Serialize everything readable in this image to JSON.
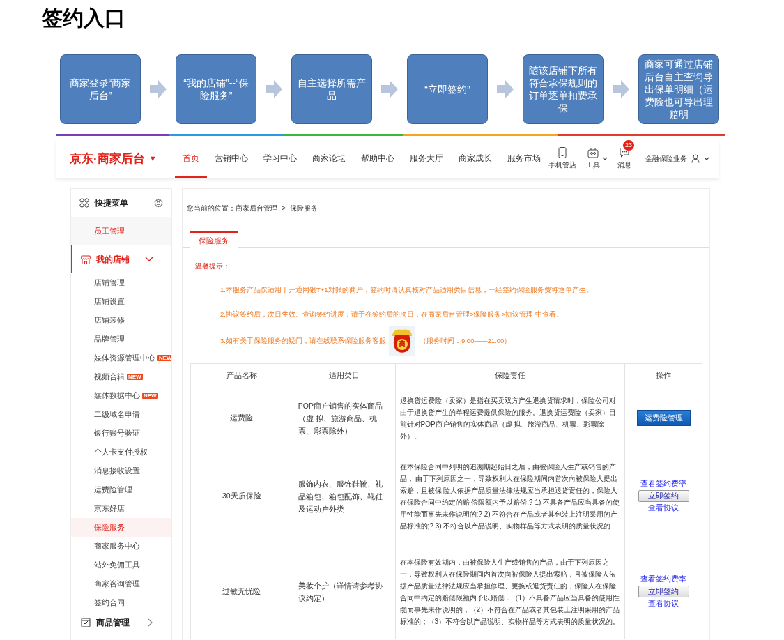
{
  "page_title": "签约入口",
  "flow": [
    {
      "text": "商家登录“商家后台”"
    },
    {
      "text": "“我的店铺”--“保险服务”"
    },
    {
      "text": "自主选择所需产品"
    },
    {
      "text": "“立即签约”"
    },
    {
      "text": "随该店铺下所有符合承保规则的订单逐单扣费承保"
    },
    {
      "text": "商家可通过店铺后台自主查询导出保单明细（运费险也可导出理赔明"
    }
  ],
  "header": {
    "logo": "京东·商家后台",
    "logo_caret": "▼",
    "nav": [
      {
        "label": "首页",
        "selected": true
      },
      {
        "label": "营销中心",
        "selected": false
      },
      {
        "label": "学习中心",
        "selected": false
      },
      {
        "label": "商家论坛",
        "selected": false
      },
      {
        "label": "帮助中心",
        "selected": false
      },
      {
        "label": "服务大厅",
        "selected": false
      },
      {
        "label": "商家成长",
        "selected": false
      },
      {
        "label": "服务市场",
        "selected": false
      }
    ],
    "tools": [
      {
        "kind": "phone",
        "label": "手机管店"
      },
      {
        "kind": "toolbox",
        "label": "工具",
        "dropdown": true
      },
      {
        "kind": "message",
        "label": "消息",
        "badge": "23"
      }
    ],
    "account": "金融保险业务"
  },
  "sidebar": {
    "quick_menu": {
      "title": "快捷菜单",
      "items": [
        {
          "label": "员工管理"
        }
      ]
    },
    "sections": [
      {
        "title": "我的店铺",
        "kind": "store",
        "expanded": true,
        "children": [
          {
            "label": "店铺管理",
            "selected": false
          },
          {
            "label": "店铺设置",
            "selected": false
          },
          {
            "label": "店铺装修",
            "selected": false
          },
          {
            "label": "品牌管理",
            "selected": false
          },
          {
            "label": "媒体资源管理中心",
            "badge": "NEW",
            "selected": false
          },
          {
            "label": "视频合辑",
            "badge": "NEW",
            "selected": false
          },
          {
            "label": "媒体数据中心",
            "badge": "NEW",
            "selected": false
          },
          {
            "label": "二级域名申请",
            "selected": false
          },
          {
            "label": "银行账号验证",
            "selected": false
          },
          {
            "label": "个人卡支付授权",
            "selected": false
          },
          {
            "label": "消息接收设置",
            "selected": false
          },
          {
            "label": "运费险管理",
            "selected": false
          },
          {
            "label": "京东好店",
            "selected": false
          },
          {
            "label": "保险服务",
            "selected": true
          },
          {
            "label": "商家服务中心",
            "selected": false
          },
          {
            "label": "站外免佣工具",
            "selected": false
          },
          {
            "label": "商家咨询管理",
            "selected": false
          },
          {
            "label": "签约合同",
            "selected": false
          }
        ]
      },
      {
        "title": "商品管理",
        "kind": "goods",
        "expanded": false
      }
    ]
  },
  "breadcrumb": {
    "prefix": "您当前的位置：商家后台管理",
    "separator": ">",
    "current": "保险服务"
  },
  "tabs": [
    {
      "label": "保险服务",
      "selected": true
    }
  ],
  "notice": {
    "title": "温馨提示：",
    "lines": [
      {
        "text": "1.本服务产品仅适用于开通网银T+1对账的商户，签约时请认真核对产品适用类目信息，一经签约保险服务费将逐单产生。"
      },
      {
        "text": "2.协议签约后，次日生效。查询签约进度，请于在签约后的次日，在商家后台管理>保险服务>协议管理 中查看。"
      },
      {
        "text": "3.如有关于保险服务的疑问，请在线联系保险服务客服",
        "service_hours": "（服务时间：9:00——21:00）"
      }
    ]
  },
  "table": {
    "columns": [
      "产品名称",
      "适用类目",
      "保险责任",
      "操作"
    ],
    "rows": [
      {
        "cells": [
          "运费险",
          "POP商户销售的实体商品（虚 拟、旅游商品、机票、彩票除外）",
          "退换货运费险（卖家）是指在买卖双方产生退换货请求时，保险公司对由于退换货产生的单程运费提供保险的服务。退换货运费险（卖家）目前针对POP商户销售的实体商品（虚 拟、旅游商品、机票、彩票除外）。"
        ],
        "actions": [
          {
            "kind": "primary",
            "label": "运费险管理"
          }
        ]
      },
      {
        "cells": [
          "30天质保险",
          "服饰内衣、服饰鞋靴、礼品箱包、箱包配饰、靴鞋及运动户外类",
          "在本保险合同中列明的追溯期起始日之后，由被保险人生产或销售的产品， 由于下列原因之一，导致权利人在保险期间内首次向被保险人提出索赔，且被保 险人依据产品质量法律法规应当承担退货责任的，保险人在保险合同中约定的赔 偿限额内予以赔偿:? 1) 不具备产品应当具备的使用性能而事先未作说明的;? 2) 不符合在产品或者其包装上注明采用的产品标准的;? 3) 不符合以产品说明、实物样品等方式表明的质量状况的"
        ],
        "actions": [
          {
            "kind": "link",
            "label": "查看签约费率"
          },
          {
            "kind": "button",
            "label": "立即签约"
          },
          {
            "kind": "link",
            "label": "查看协议"
          }
        ]
      },
      {
        "cells": [
          "过敏无忧险",
          "美妆个护（详情请参考协议约定）",
          "在本保险有效期内，由被保险人生产或销售的产品，由于下列原因之一，导致权利人在保险期间内首次向被保险人提出索赔，且被保险人依据产品质量法律法规应当承担修理、更换或退货责任的，保险人在保险合同中约定的赔偿限额内予以赔偿：（1）不具备产品应当具备的使用性能而事先未作说明的；（2）不符合在产品或者其包装上注明采用的产品标准的；（3）不符合以产品说明、实物样品等方式表明的质量状况的。"
        ],
        "actions": [
          {
            "kind": "link",
            "label": "查看签约费率"
          },
          {
            "kind": "button",
            "label": "立即签约"
          },
          {
            "kind": "link",
            "label": "查看协议"
          }
        ]
      }
    ]
  }
}
